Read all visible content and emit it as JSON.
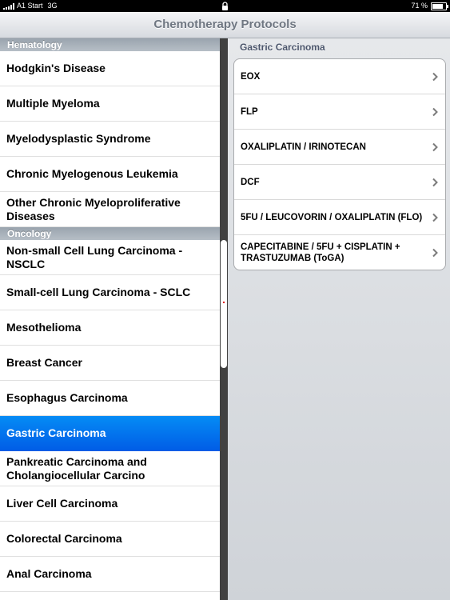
{
  "status_bar": {
    "carrier": "A1 Start",
    "network": "3G",
    "battery": "71 %"
  },
  "nav": {
    "title": "Chemotherapy Protocols"
  },
  "master": {
    "sections": [
      {
        "header": "Hematology",
        "items": [
          "Hodgkin's Disease",
          "Multiple Myeloma",
          "Myelodysplastic Syndrome",
          "Chronic Myelogenous Leukemia",
          "Other Chronic Myeloproliferative Diseases"
        ]
      },
      {
        "header": "Oncology",
        "items": [
          "Non-small Cell Lung Carcinoma - NSCLC",
          "Small-cell Lung Carcinoma - SCLC",
          "Mesothelioma",
          "Breast Cancer",
          "Esophagus Carcinoma",
          "Gastric Carcinoma",
          "Pankreatic Carcinoma and Cholangiocellular Carcino",
          "Liver Cell Carcinoma",
          "Colorectal Carcinoma",
          "Anal Carcinoma"
        ]
      }
    ],
    "selected": "Gastric Carcinoma"
  },
  "detail": {
    "title": "Gastric Carcinoma",
    "protocols": [
      "EOX",
      "FLP",
      "OXALIPLATIN / IRINOTECAN",
      "DCF",
      "5FU / LEUCOVORIN / OXALIPLATIN (FLO)",
      "CAPECITABINE / 5FU + CISPLATIN + TRASTUZUMAB (ToGA)"
    ]
  },
  "colors": {
    "selection": "#0268e8",
    "section_header": "#a7b0b9",
    "nav_title": "#6f7782"
  }
}
